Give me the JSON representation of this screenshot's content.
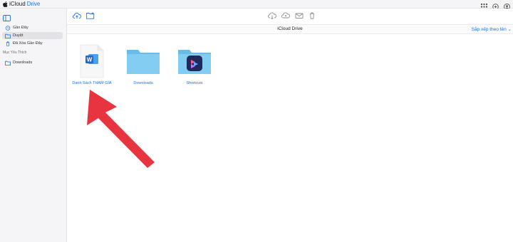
{
  "header": {
    "brand_part1": "iCloud",
    "brand_part2": "Drive"
  },
  "sidebar": {
    "items": [
      {
        "label": "Gần Đây"
      },
      {
        "label": "Duyệt"
      },
      {
        "label": "Đã Xóa Gần Đây"
      }
    ],
    "section_title": "Mục Yêu Thích",
    "favorites": [
      {
        "label": "Downloads"
      }
    ]
  },
  "path": {
    "title": "iCloud Drive"
  },
  "sort": {
    "label": "Sắp xếp theo tên ⌄"
  },
  "files": [
    {
      "name": "Danh Sách THAM GIA",
      "kind": "word-document"
    },
    {
      "name": "Downloads",
      "kind": "folder"
    },
    {
      "name": "Shortcuts",
      "kind": "folder-shortcuts"
    }
  ],
  "colors": {
    "accent": "#1a73e8",
    "folder": "#7cc8ef",
    "arrow": "#e8343f",
    "word": "#2b66c6"
  }
}
